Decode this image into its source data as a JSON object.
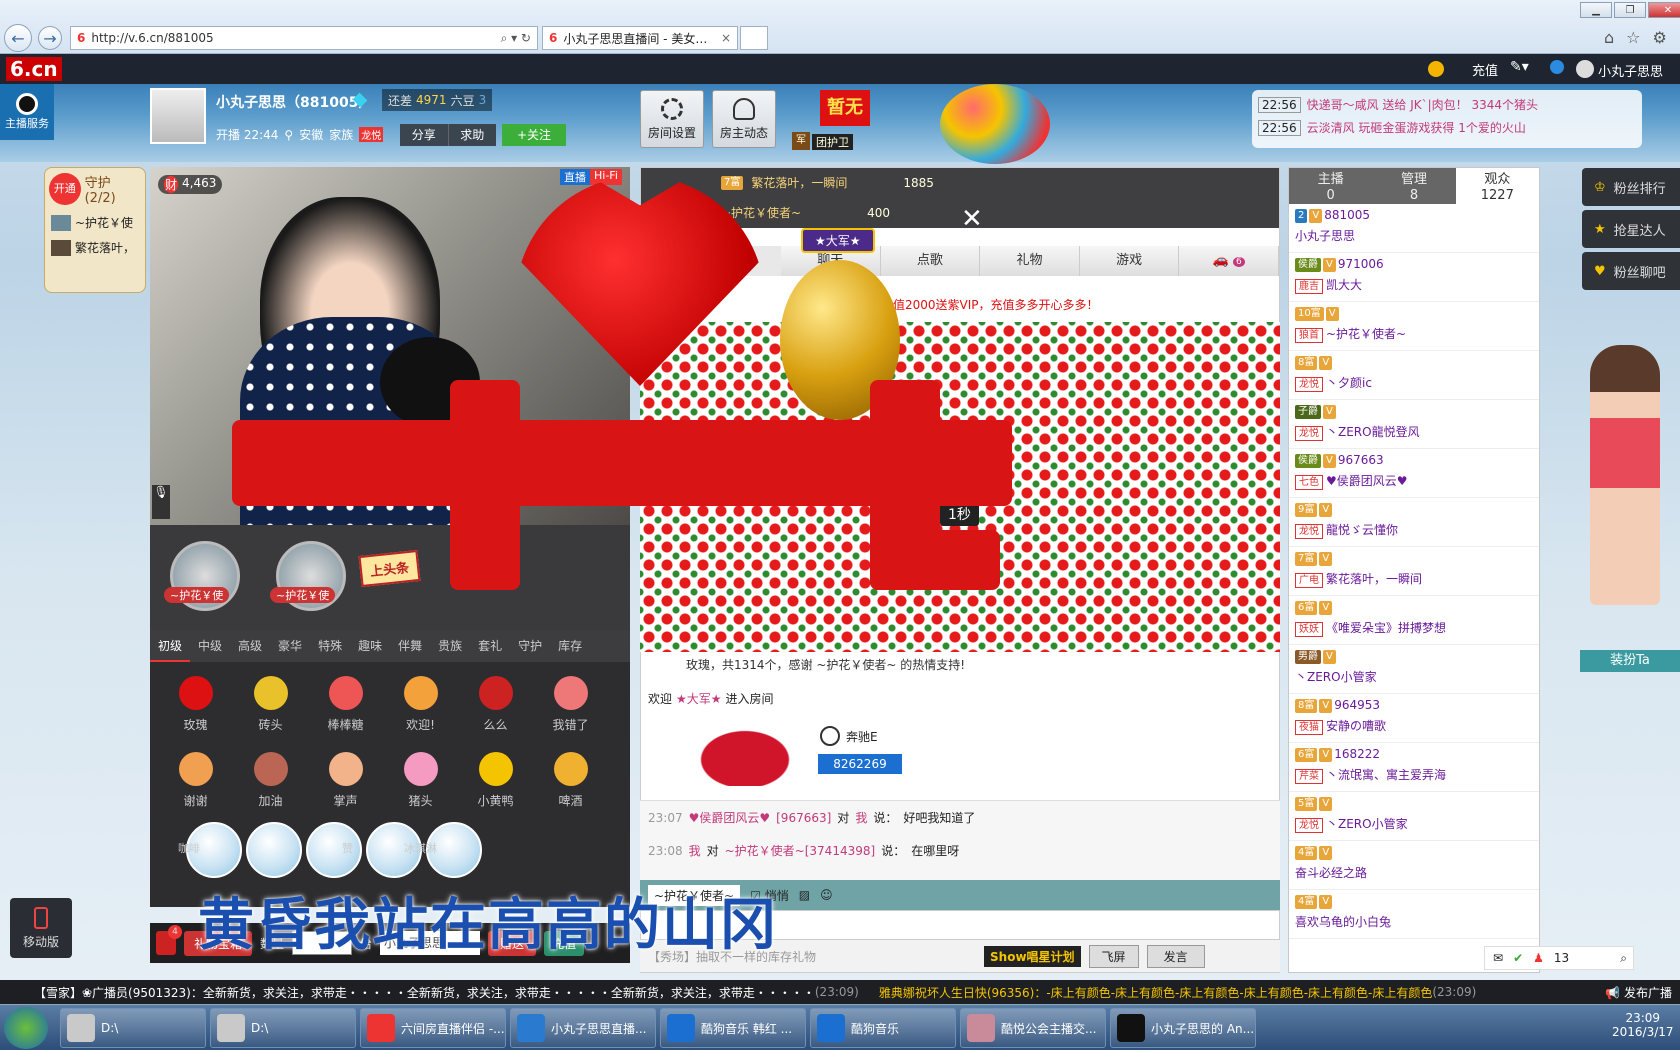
{
  "browser": {
    "url": "http://v.6.cn/881005",
    "tab_title": "小丸子思思直播间 - 美女…",
    "tab_close": "×"
  },
  "site": {
    "logo": "6.cn",
    "service_label": "主播服务",
    "recharge": "充值",
    "username": "小丸子思思"
  },
  "host": {
    "name": "小丸子思思（881005）",
    "gap_label": "还差",
    "gap_value": "4971",
    "gap_unit": "六豆",
    "level": "3",
    "start": "开播 22:44",
    "location": "安徽",
    "family_label": "家族",
    "family_tag": "龙悦",
    "share": "分享",
    "help": "求助",
    "follow": "+关注"
  },
  "header_buttons": [
    {
      "label": "房间设置",
      "icon": "gear-icon"
    },
    {
      "label": "房主动态",
      "icon": "person-icon"
    }
  ],
  "guard": {
    "label": "暂无",
    "sub": "团护卫",
    "army": "军"
  },
  "announcements": [
    {
      "time": "22:56",
      "text": "快递哥～咸风 送给 JK`|肉包！ 3344个猪头"
    },
    {
      "time": "22:56",
      "text": "云淡清风 玩砸金蛋游戏获得 1个爱的火山"
    }
  ],
  "left_guard": {
    "open": "开通",
    "title": "守护(2/2)",
    "items": [
      "~护花￥使",
      "繁花落叶，"
    ]
  },
  "video": {
    "wealth": "4,463",
    "live": "直播",
    "hifi": "Hi-Fi"
  },
  "seats": {
    "names": [
      "~护花￥使",
      "~护花￥使"
    ],
    "headline": "上头条"
  },
  "gift_tabs": [
    "初级",
    "中级",
    "高级",
    "豪华",
    "特殊",
    "趣味",
    "伴舞",
    "贵族",
    "套礼",
    "守护",
    "库存"
  ],
  "gifts": [
    {
      "name": "玫瑰",
      "color": "#d11"
    },
    {
      "name": "砖头",
      "color": "#e9c12a"
    },
    {
      "name": "棒棒糖",
      "color": "#e55"
    },
    {
      "name": "欢迎!",
      "color": "#f3a13b"
    },
    {
      "name": "么么",
      "color": "#c22"
    },
    {
      "name": "我错了",
      "color": "#e77"
    },
    {
      "name": "谢谢",
      "color": "#f0a050"
    },
    {
      "name": "加油",
      "color": "#b65"
    },
    {
      "name": "掌声",
      "color": "#f2b28a"
    },
    {
      "name": "猪头",
      "color": "#f59ac0"
    },
    {
      "name": "小黄鸭",
      "color": "#f5c400"
    },
    {
      "name": "啤酒",
      "color": "#f0b030"
    }
  ],
  "gift_row3": [
    "咖啡",
    "赞",
    "冰淇淋"
  ],
  "overlay_text": "黄昏我站在高高的山冈",
  "gift_bar": {
    "box": "礼物宝箱",
    "qty": "数量",
    "to": "给",
    "recipient": "小丸子思思",
    "send": "赠送",
    "recharge": "充值",
    "count": "4"
  },
  "chat_top": [
    {
      "badge": "7富",
      "name": "繁花落叶，一瞬间",
      "num": "1885"
    },
    {
      "name": "~护花￥使者~",
      "num": "400"
    }
  ],
  "army_label": "★大军★",
  "chat_tabs": [
    "聊天",
    "点歌",
    "礼物",
    "游戏"
  ],
  "chat_car_count": "6",
  "promo": "值当天累计充值2000送紫VIP，充值多多开心多多！",
  "countdown": "1秒",
  "rose_msg": "玫瑰，共1314个，感谢 ~护花￥使者~ 的热情支持!",
  "welcome": {
    "prefix": "欢迎",
    "name": "★大军★",
    "suffix": "进入房间"
  },
  "car": {
    "name": "奔驰E",
    "id": "8262269"
  },
  "messages": [
    {
      "time": "23:07",
      "from": "♥侯爵团风云♥",
      "id": "[967663]",
      "to": "我",
      "text": "好吧我知道了"
    },
    {
      "time": "23:08",
      "from": "我",
      "to": "~护花￥使者~[37414398]",
      "text": "在哪里呀"
    }
  ],
  "input": {
    "recipient": "~护花￥使者~",
    "quiet": "悄悄",
    "hint": "【秀场】抽取不一样的库存礼物",
    "flyscreen": "飞屏",
    "speak": "发言",
    "show": "Show唱星计划"
  },
  "user_tabs": [
    {
      "label": "主播",
      "count": "0"
    },
    {
      "label": "管理",
      "count": "8"
    },
    {
      "label": "观众",
      "count": "1227"
    }
  ],
  "users": [
    {
      "badge": "2",
      "id": "881005",
      "name": "小丸子思思",
      "tag": ""
    },
    {
      "badge": "侯爵",
      "id": "971006",
      "name": "凯大大",
      "tag": "鹿吉"
    },
    {
      "badge": "10富",
      "id": "",
      "name": "~护花￥使者~",
      "tag": "狼首"
    },
    {
      "badge": "8富",
      "id": "",
      "name": "丶夕颜ic",
      "tag": "龙悦"
    },
    {
      "badge": "子爵",
      "id": "",
      "name": "丶ZERO龍悦登风",
      "tag": "龙悦"
    },
    {
      "badge": "侯爵",
      "id": "967663",
      "name": "♥侯爵团风云♥",
      "tag": "七色"
    },
    {
      "badge": "9富",
      "id": "",
      "name": "龍悦ゞ云懂你",
      "tag": "龙悦"
    },
    {
      "badge": "7富",
      "id": "",
      "name": "繁花落叶，一瞬间",
      "tag": "广电"
    },
    {
      "badge": "6富",
      "id": "",
      "name": "《唯爱朵宝》拼搏梦想",
      "tag": "妖妖"
    },
    {
      "badge": "男爵",
      "id": "",
      "name": "丶ZERO小管家",
      "tag": ""
    },
    {
      "badge": "8富",
      "id": "964953",
      "name": "安静の嘈歌",
      "tag": "夜猫"
    },
    {
      "badge": "6富",
      "id": "168222",
      "name": "丶流氓寓、寓主爱弄海",
      "tag": "芹菜"
    },
    {
      "badge": "5富",
      "id": "",
      "name": "丶ZERO小管家",
      "tag": "龙悦"
    },
    {
      "badge": "4富",
      "id": "",
      "name": "奋斗必经之路",
      "tag": ""
    },
    {
      "badge": "4富",
      "id": "",
      "name": "喜欢乌龟的小白兔",
      "tag": ""
    }
  ],
  "user_footer": {
    "count": "13"
  },
  "side_buttons": [
    "粉丝排行",
    "抢星达人",
    "粉丝聊吧"
  ],
  "dress_btn": "装扮Ta",
  "mobile": "移动版",
  "ticker": {
    "text": "【雪家】❀广播员(9501323)：全新新货，求关注，求带走・・・・・全新新货，求关注，求带走・・・・・全新新货，求关注，求带走・・・・・",
    "time": "(23:09)",
    "text2": "雅典娜祝坏人生日快(96356)：-床上有颜色-床上有颜色-床上有颜色-床上有颜色-床上有颜色-床上有颜色",
    "time2": "(23:09)",
    "broadcast": "发布广播"
  },
  "taskbar": {
    "items": [
      "D:\\",
      "D:\\",
      "六间房直播伴侣 -...",
      "小丸子思思直播...",
      "酷狗音乐 韩红 ...",
      "酷狗音乐",
      "酷悦公会主播交...",
      "小丸子思思的 An..."
    ],
    "time": "23:09",
    "date": "2016/3/17"
  }
}
